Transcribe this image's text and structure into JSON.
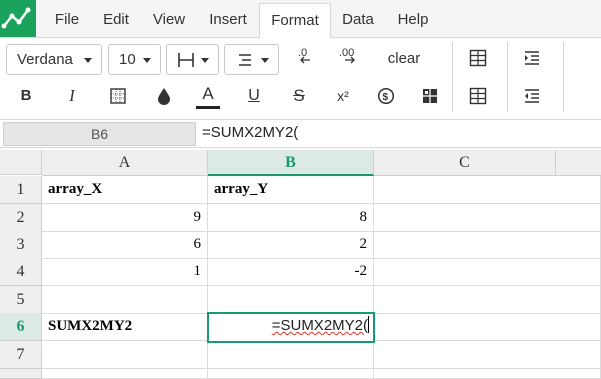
{
  "menu": {
    "items": [
      "File",
      "Edit",
      "View",
      "Insert",
      "Format",
      "Data",
      "Help"
    ],
    "active": "Format"
  },
  "toolbar": {
    "font": "Verdana",
    "font_size": "10",
    "clear_label": "clear",
    "bold_label": "B",
    "italic_label": "I",
    "font_color_label": "A",
    "underline_label": "U",
    "strike_label": "S",
    "superscript_label": "x²"
  },
  "formula_bar": {
    "cell_ref": "B6",
    "formula": "=SUMX2MY2("
  },
  "columns": [
    "A",
    "B",
    "C"
  ],
  "rows": [
    "1",
    "2",
    "3",
    "4",
    "5",
    "6",
    "7"
  ],
  "cells": {
    "A1": "array_X",
    "B1": "array_Y",
    "A2": "9",
    "B2": "8",
    "A3": "6",
    "B3": "2",
    "A4": "1",
    "B4": "-2",
    "A6": "SUMX2MY2"
  },
  "editor": {
    "text": "=SUMX2MY2("
  },
  "colors": {
    "accent": "#1a9a6c",
    "logo": "#1aa25c"
  }
}
